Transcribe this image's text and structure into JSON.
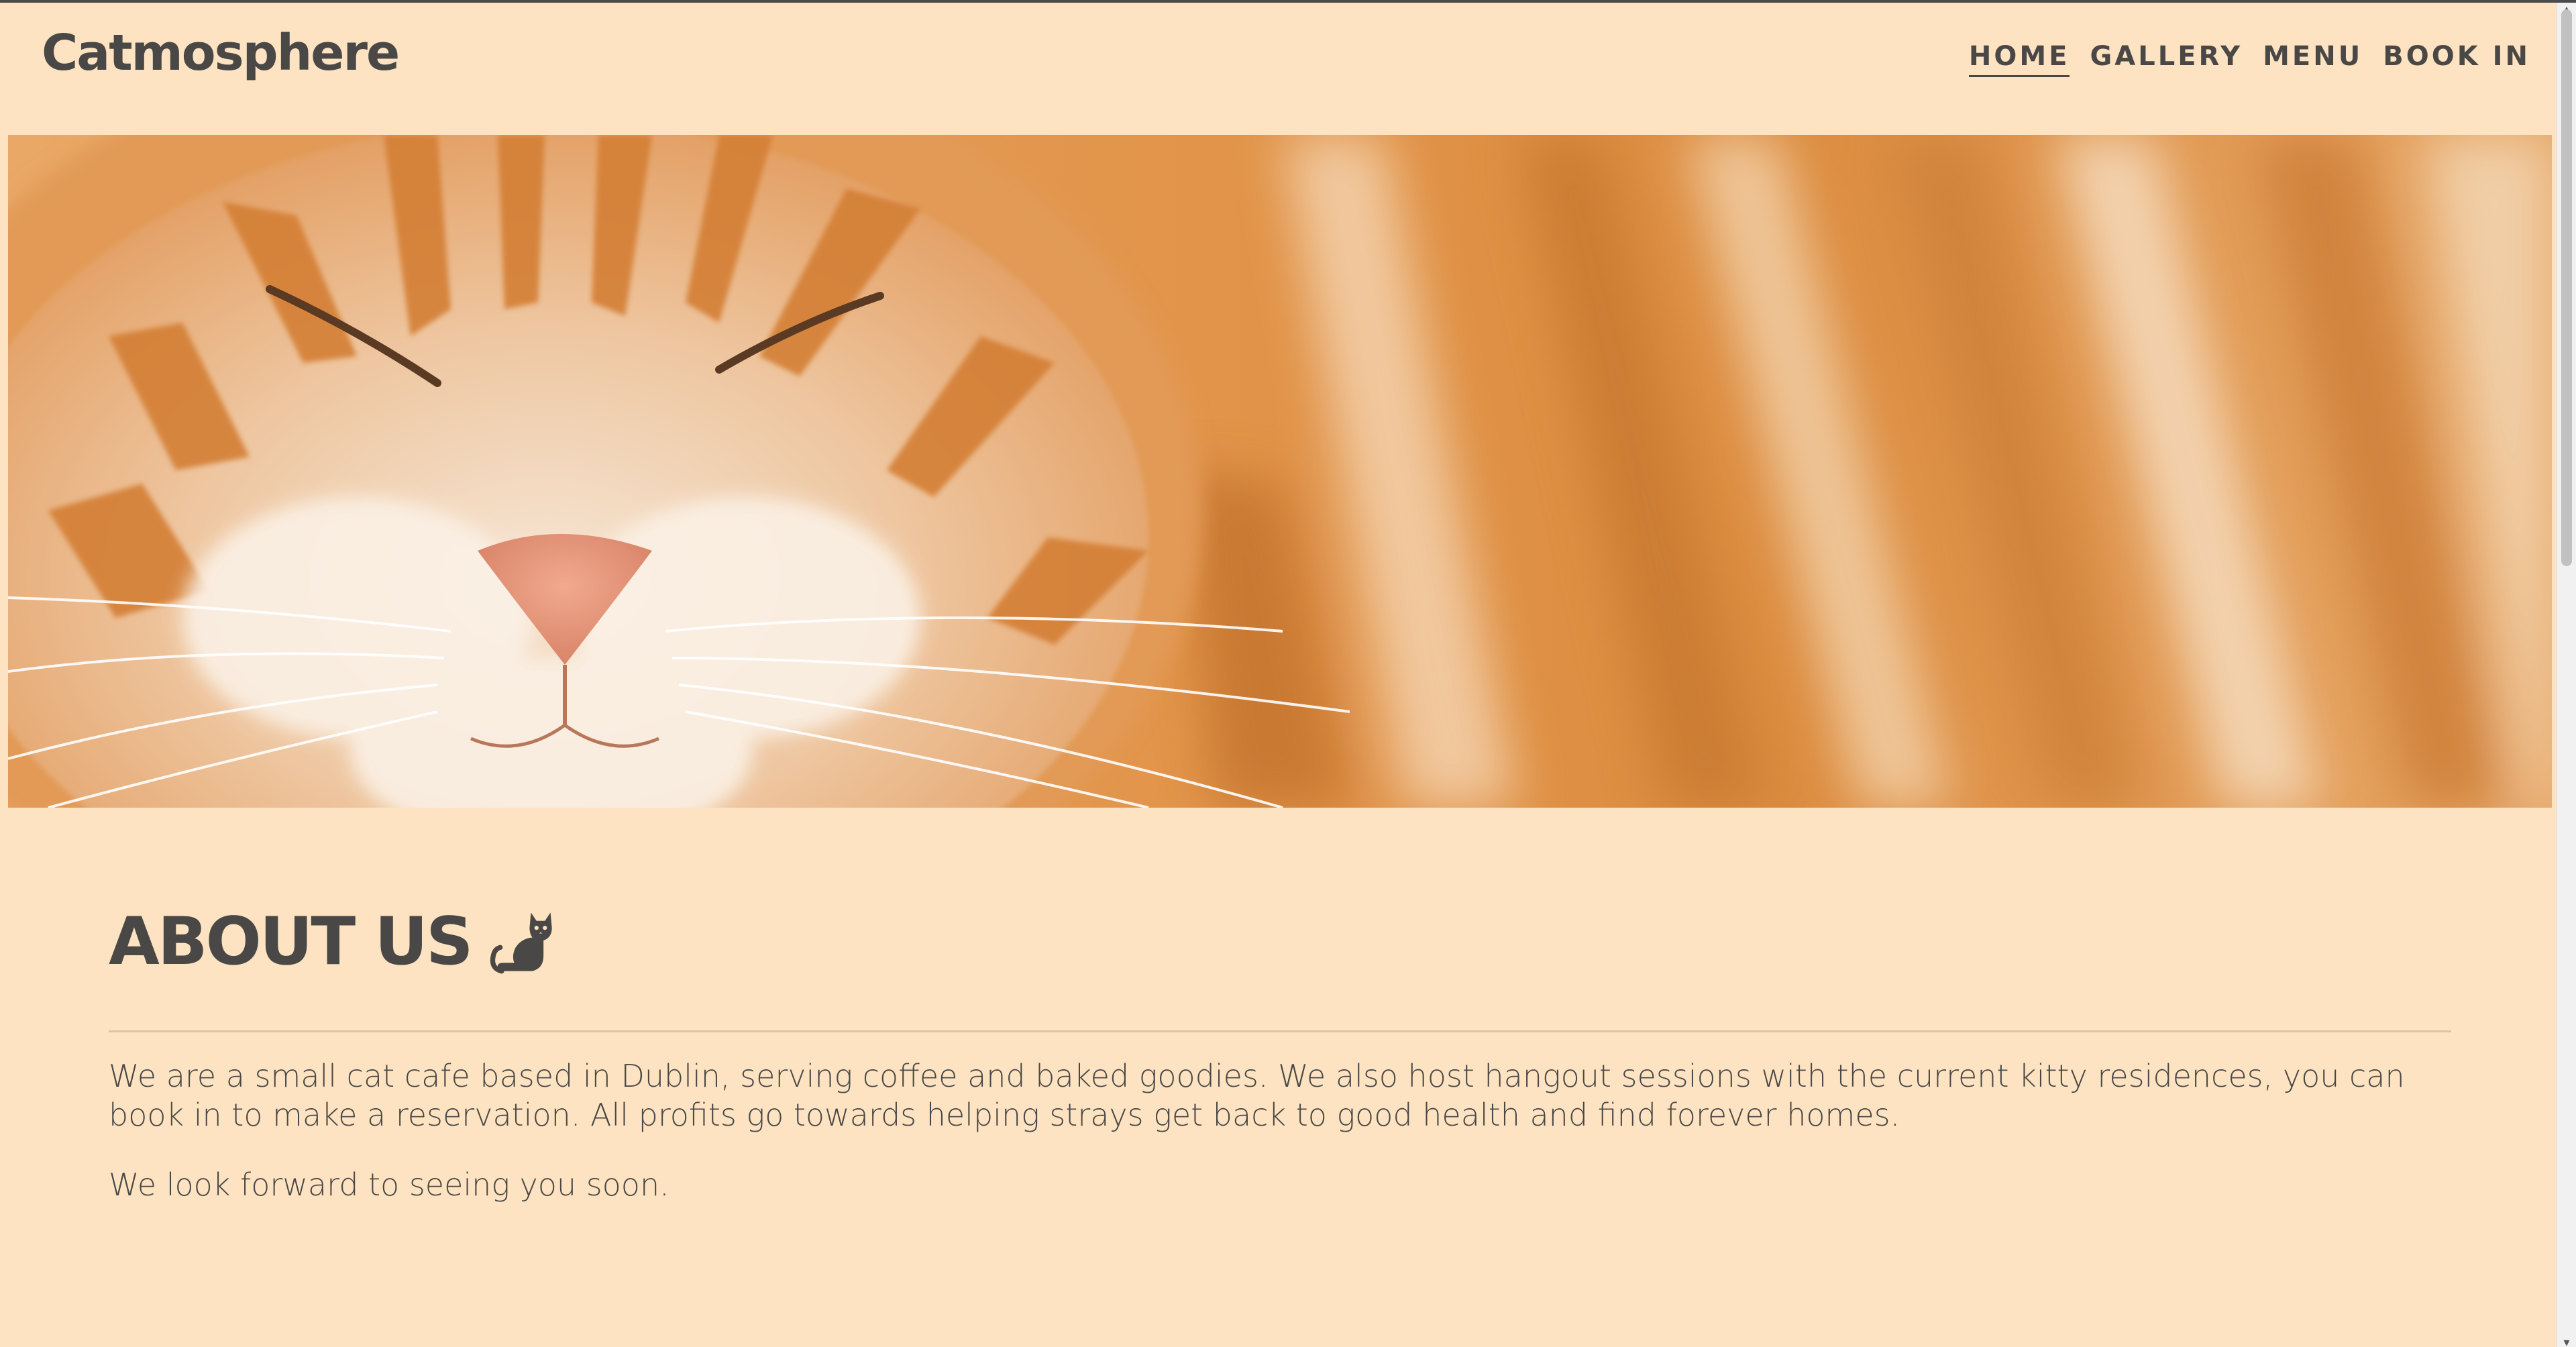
{
  "brand": {
    "name": "Catmosphere"
  },
  "nav": {
    "items": [
      {
        "label": "HOME",
        "active": true
      },
      {
        "label": "GALLERY",
        "active": false
      },
      {
        "label": "MENU",
        "active": false
      },
      {
        "label": "BOOK IN",
        "active": false
      }
    ]
  },
  "hero": {
    "subject": "sleeping ginger cat close-up"
  },
  "about": {
    "title": "ABOUT US",
    "icon": "cat-icon",
    "paragraph1": "We are a small cat cafe based in Dublin, serving coffee and baked goodies. We also host hangout sessions with the current kitty residences, you can book in to make a reservation. All profits go towards helping strays get back to good health and find forever homes.",
    "paragraph2": "We look forward to seeing you soon."
  },
  "colors": {
    "background": "#fde3c1",
    "text": "#4a4846",
    "divider": "#d8c4aa"
  }
}
